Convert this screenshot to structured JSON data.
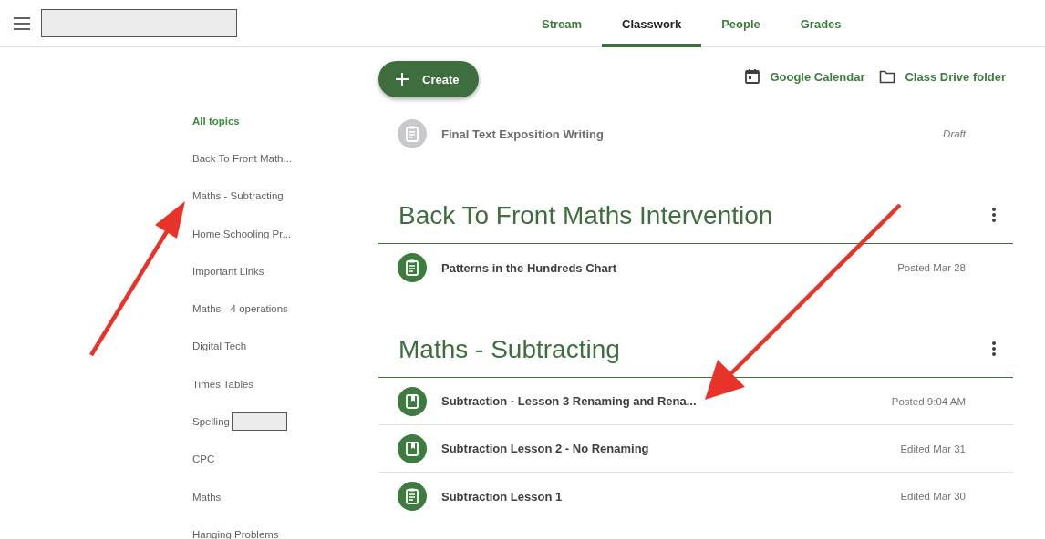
{
  "tabs": [
    {
      "label": "Stream",
      "selected": false
    },
    {
      "label": "Classwork",
      "selected": true
    },
    {
      "label": "People",
      "selected": false
    },
    {
      "label": "Grades",
      "selected": false
    }
  ],
  "toolbar": {
    "create_label": "Create",
    "links": [
      {
        "kind": "calendar",
        "label": "Google Calendar"
      },
      {
        "kind": "folder",
        "label": "Class Drive folder"
      }
    ]
  },
  "topics": [
    {
      "label": "All topics",
      "selected": true,
      "redacted": false
    },
    {
      "label": "Back To Front Math...",
      "selected": false,
      "redacted": false
    },
    {
      "label": "Maths - Subtracting",
      "selected": false,
      "redacted": false
    },
    {
      "label": "Home Schooling Pr...",
      "selected": false,
      "redacted": false
    },
    {
      "label": "Important Links",
      "selected": false,
      "redacted": false
    },
    {
      "label": "Maths - 4 operations",
      "selected": false,
      "redacted": false
    },
    {
      "label": "Digital Tech",
      "selected": false,
      "redacted": false
    },
    {
      "label": "Times Tables",
      "selected": false,
      "redacted": false
    },
    {
      "label": "Spelling",
      "selected": false,
      "redacted": true
    },
    {
      "label": "CPC",
      "selected": false,
      "redacted": false
    },
    {
      "label": "Maths",
      "selected": false,
      "redacted": false
    },
    {
      "label": "Hanging Problems",
      "selected": false,
      "redacted": false
    }
  ],
  "ungrouped": [
    {
      "title": "Final Text Exposition Writing",
      "status": "Draft",
      "kind": "assignment",
      "draft": true
    }
  ],
  "sections": [
    {
      "title": "Back To Front Maths Intervention",
      "items": [
        {
          "title": "Patterns in the Hundreds Chart",
          "status": "Posted Mar 28",
          "kind": "assignment",
          "draft": false
        }
      ]
    },
    {
      "title": "Maths - Subtracting",
      "items": [
        {
          "title": "Subtraction - Lesson 3 Renaming and Rena...",
          "status": "Posted 9:04 AM",
          "kind": "material",
          "draft": false
        },
        {
          "title": "Subtraction Lesson 2 - No Renaming",
          "status": "Edited Mar 31",
          "kind": "material",
          "draft": false
        },
        {
          "title": "Subtraction Lesson 1",
          "status": "Edited Mar 30",
          "kind": "assignment",
          "draft": false
        }
      ]
    }
  ]
}
